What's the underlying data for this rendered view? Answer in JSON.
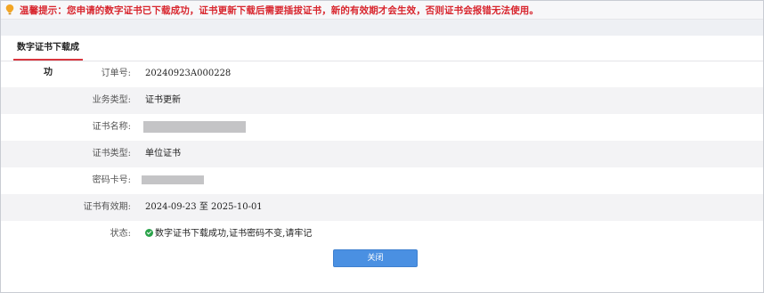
{
  "notice": {
    "text": "温馨提示：您申请的数字证书已下载成功，证书更新下载后需要插拔证书，新的有效期才会生效，否则证书会报错无法使用。"
  },
  "tab": {
    "label": "数字证书下载成功"
  },
  "fields": {
    "order_no": {
      "label": "订单号:",
      "value": "20240923A000228"
    },
    "business_type": {
      "label": "业务类型:",
      "value": "证书更新"
    },
    "cert_name": {
      "label": "证书名称:"
    },
    "cert_type": {
      "label": "证书类型:",
      "value": "单位证书"
    },
    "pin_card": {
      "label": "密码卡号:"
    },
    "validity": {
      "label": "证书有效期:",
      "value": "2024-09-23 至 2025-10-01"
    },
    "status": {
      "label": "状态:",
      "value": "数字证书下载成功,证书密码不变,请牢记"
    }
  },
  "buttons": {
    "close": "关闭"
  }
}
